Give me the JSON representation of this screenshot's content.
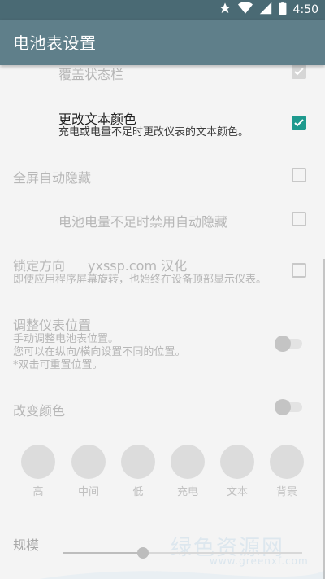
{
  "status_bar": {
    "time": "4:50",
    "icons": [
      "star-icon",
      "wifi-icon",
      "signal-icon",
      "battery-icon"
    ]
  },
  "app_bar": {
    "title": "电池表设置"
  },
  "settings": {
    "overlay_status_bar": {
      "title": "覆盖状态栏",
      "checked": true,
      "enabled": false
    },
    "change_text_color": {
      "title": "更改文本颜色",
      "summary": "充电或电量不足时更改仪表的文本颜色。",
      "checked": true,
      "enabled": true
    },
    "fullscreen_auto_hide": {
      "title": "全屏自动隐藏",
      "checked": false,
      "enabled": false
    },
    "low_battery_disable_hide": {
      "title": "电池电量不足时禁用自动隐藏",
      "checked": false,
      "enabled": false
    },
    "lock_orientation": {
      "title": "锁定方向",
      "credit": "yxssp.com 汉化",
      "summary": "即使应用程序屏幕旋转，也始终在设备顶部显示仪表。",
      "checked": false,
      "enabled": false
    },
    "adjust_position": {
      "title": "调整仪表位置",
      "summary_lines": [
        "手动调整电池表位置。",
        "您可以在纵向/横向设置不同的位置。",
        "*双击可重置位置。"
      ],
      "on": false
    },
    "change_colors": {
      "title": "改变颜色",
      "on": false
    },
    "color_swatches": [
      "高",
      "中间",
      "低",
      "充电",
      "文本",
      "背景"
    ],
    "scale": {
      "title": "规模",
      "value_fraction": 0.33
    }
  },
  "watermark": {
    "text": "绿色资源网",
    "sub": "www.greenxf.com"
  },
  "colors": {
    "app_bar": "#5f7f8a",
    "status_bar": "#4a6a74",
    "accent": "#1e9a8e",
    "disabled_text": "#b7b7b7"
  }
}
